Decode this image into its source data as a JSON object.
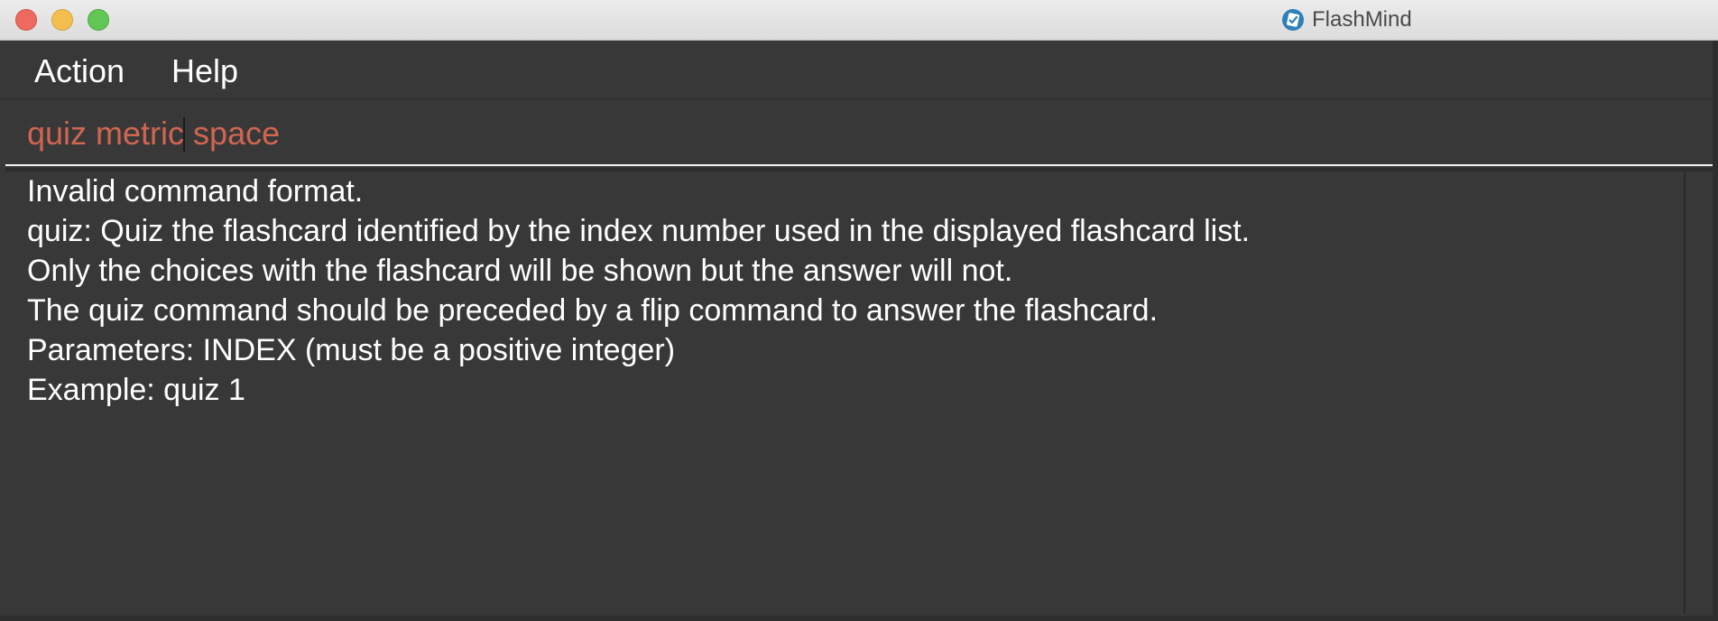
{
  "window": {
    "title": "FlashMind",
    "app_icon": "flashmind-app-icon"
  },
  "menu": {
    "items": [
      {
        "label": "Action"
      },
      {
        "label": "Help"
      }
    ]
  },
  "command": {
    "value_before_caret": "quiz metric",
    "value_after_caret": " space",
    "text_color": "#d06651"
  },
  "result": {
    "lines": [
      "Invalid command format.",
      "quiz: Quiz the flashcard identified by the index number used in the displayed flashcard list.",
      "Only the choices with the flashcard will be shown but the answer will not.",
      "The quiz command should be preceded by a flip command to answer the flashcard.",
      "Parameters: INDEX (must be a positive integer)",
      "Example: quiz 1"
    ]
  },
  "colors": {
    "background": "#383838",
    "text": "#ffffff",
    "error_input": "#d06651"
  }
}
